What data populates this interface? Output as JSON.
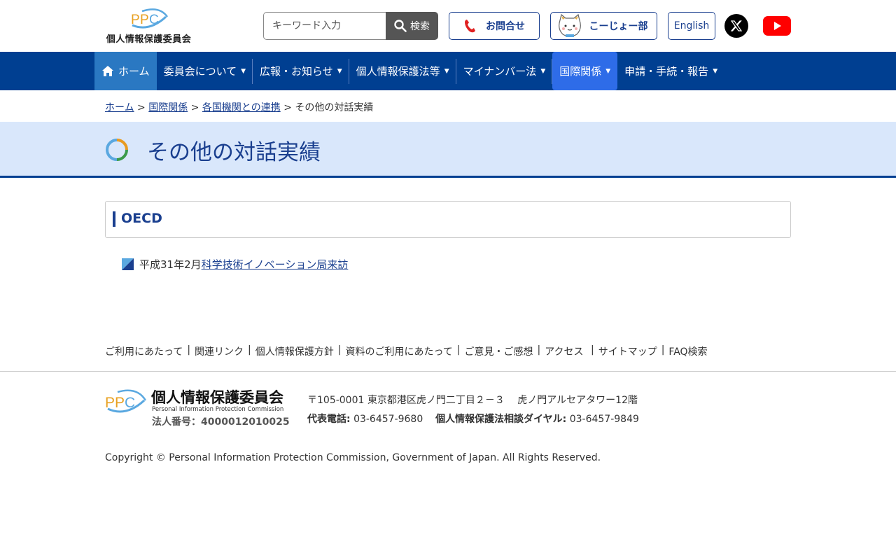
{
  "header": {
    "logo_text": "個人情報保護委員会",
    "search_placeholder": "キーワード入力",
    "search_button": "検索",
    "contact_button": "お問合せ",
    "kojo_button": "こーじょー部",
    "english_button": "English"
  },
  "nav": {
    "home": "ホーム",
    "items": [
      "委員会について",
      "広報・お知らせ",
      "個人情報保護法等",
      "マイナンバー法",
      "国際関係",
      "申請・手続・報告"
    ]
  },
  "breadcrumb": {
    "home": "ホーム",
    "international": "国際関係",
    "cooperation": "各国機関との連携",
    "current": "その他の対話実績"
  },
  "page_title": "その他の対話実績",
  "section": {
    "title": "OECD",
    "item_prefix": "平成31年2月",
    "item_link": "科学技術イノベーション局来訪"
  },
  "footer": {
    "links": [
      "ご利用にあたって",
      "関連リンク",
      "個人情報保護方針",
      "資料のご利用にあたって",
      "ご意見・ご感想",
      "アクセス",
      "サイトマップ",
      "FAQ検索"
    ],
    "org_name": "個人情報保護委員会",
    "org_name_en": "Personal Information Protection Commission",
    "corp_number": "法人番号：4000012010025",
    "address": "〒105-0001 東京都港区虎ノ門二丁目２－３　 虎ノ門アルセアタワー12階",
    "tel_label": "代表電話:",
    "tel": "03-6457-9680",
    "consult_label": "個人情報保護法相談ダイヤル:",
    "consult_tel": "03-6457-9849",
    "copyright": "Copyright © Personal Information Protection Commission, Government of Japan. All Rights Reserved."
  },
  "colors": {
    "nav_bg": "#003f91",
    "nav_home": "#2a78c2",
    "nav_active": "#2e6ce8",
    "title_band": "#d9e7fb",
    "accent": "#1a3f8f"
  }
}
